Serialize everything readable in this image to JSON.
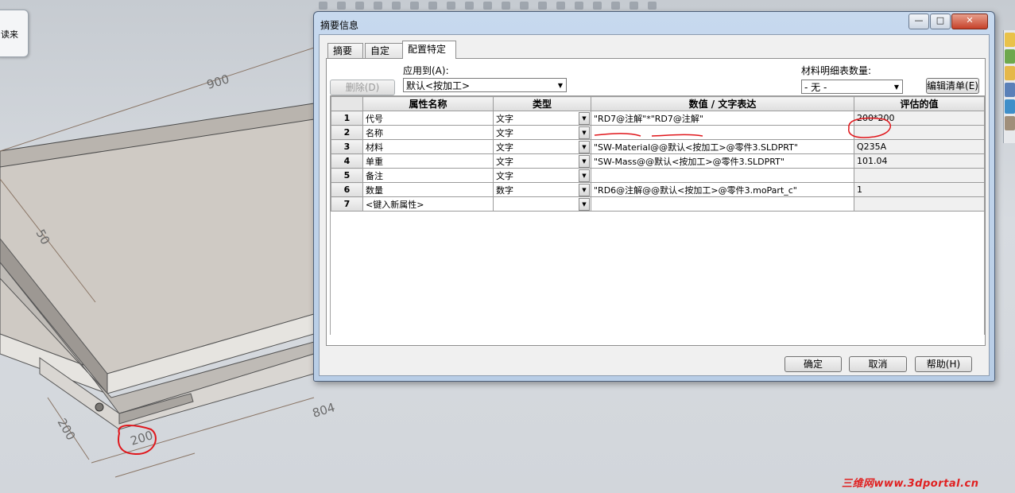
{
  "viewport": {
    "dimensions": [
      "900",
      "50",
      "804",
      "200",
      "200"
    ],
    "popup_text": "读来",
    "watermark": "三维网www.3dportal.cn"
  },
  "dialog": {
    "title": "摘要信息",
    "tabs": [
      {
        "label": "摘要",
        "active": false
      },
      {
        "label": "自定义",
        "active": false
      },
      {
        "label": "配置特定",
        "active": true
      }
    ],
    "apply_to_label": "应用到(A):",
    "apply_to_value": "默认<按加工>",
    "delete_button": "删除(D)",
    "bom_qty_label": "材料明细表数量:",
    "bom_qty_value": "- 无 -",
    "edit_list_button": "编辑清单(E)",
    "table": {
      "headers": [
        "属性名称",
        "类型",
        "数值 / 文字表达",
        "评估的值"
      ],
      "rows": [
        {
          "num": "1",
          "name": "代号",
          "type": "文字",
          "value": "\"RD7@注解\"*\"RD7@注解\"",
          "evaluated": "200*200"
        },
        {
          "num": "2",
          "name": "名称",
          "type": "文字",
          "value": "",
          "evaluated": ""
        },
        {
          "num": "3",
          "name": "材料",
          "type": "文字",
          "value": "\"SW-Material@@默认<按加工>@零件3.SLDPRT\"",
          "evaluated": "Q235A"
        },
        {
          "num": "4",
          "name": "单重",
          "type": "文字",
          "value": "\"SW-Mass@@默认<按加工>@零件3.SLDPRT\"",
          "evaluated": "101.04"
        },
        {
          "num": "5",
          "name": "备注",
          "type": "文字",
          "value": "",
          "evaluated": ""
        },
        {
          "num": "6",
          "name": "数量",
          "type": "数字",
          "value": "\"RD6@注解@@默认<按加工>@零件3.moPart_c\"",
          "evaluated": "1"
        },
        {
          "num": "7",
          "name": "<键入新属性>",
          "type": "",
          "value": "",
          "evaluated": ""
        }
      ]
    },
    "ok_button": "确定",
    "cancel_button": "取消",
    "help_button": "帮助(H)",
    "colors": {
      "annotation": "#e0161b",
      "title_bar": "#c7d9ee"
    }
  }
}
